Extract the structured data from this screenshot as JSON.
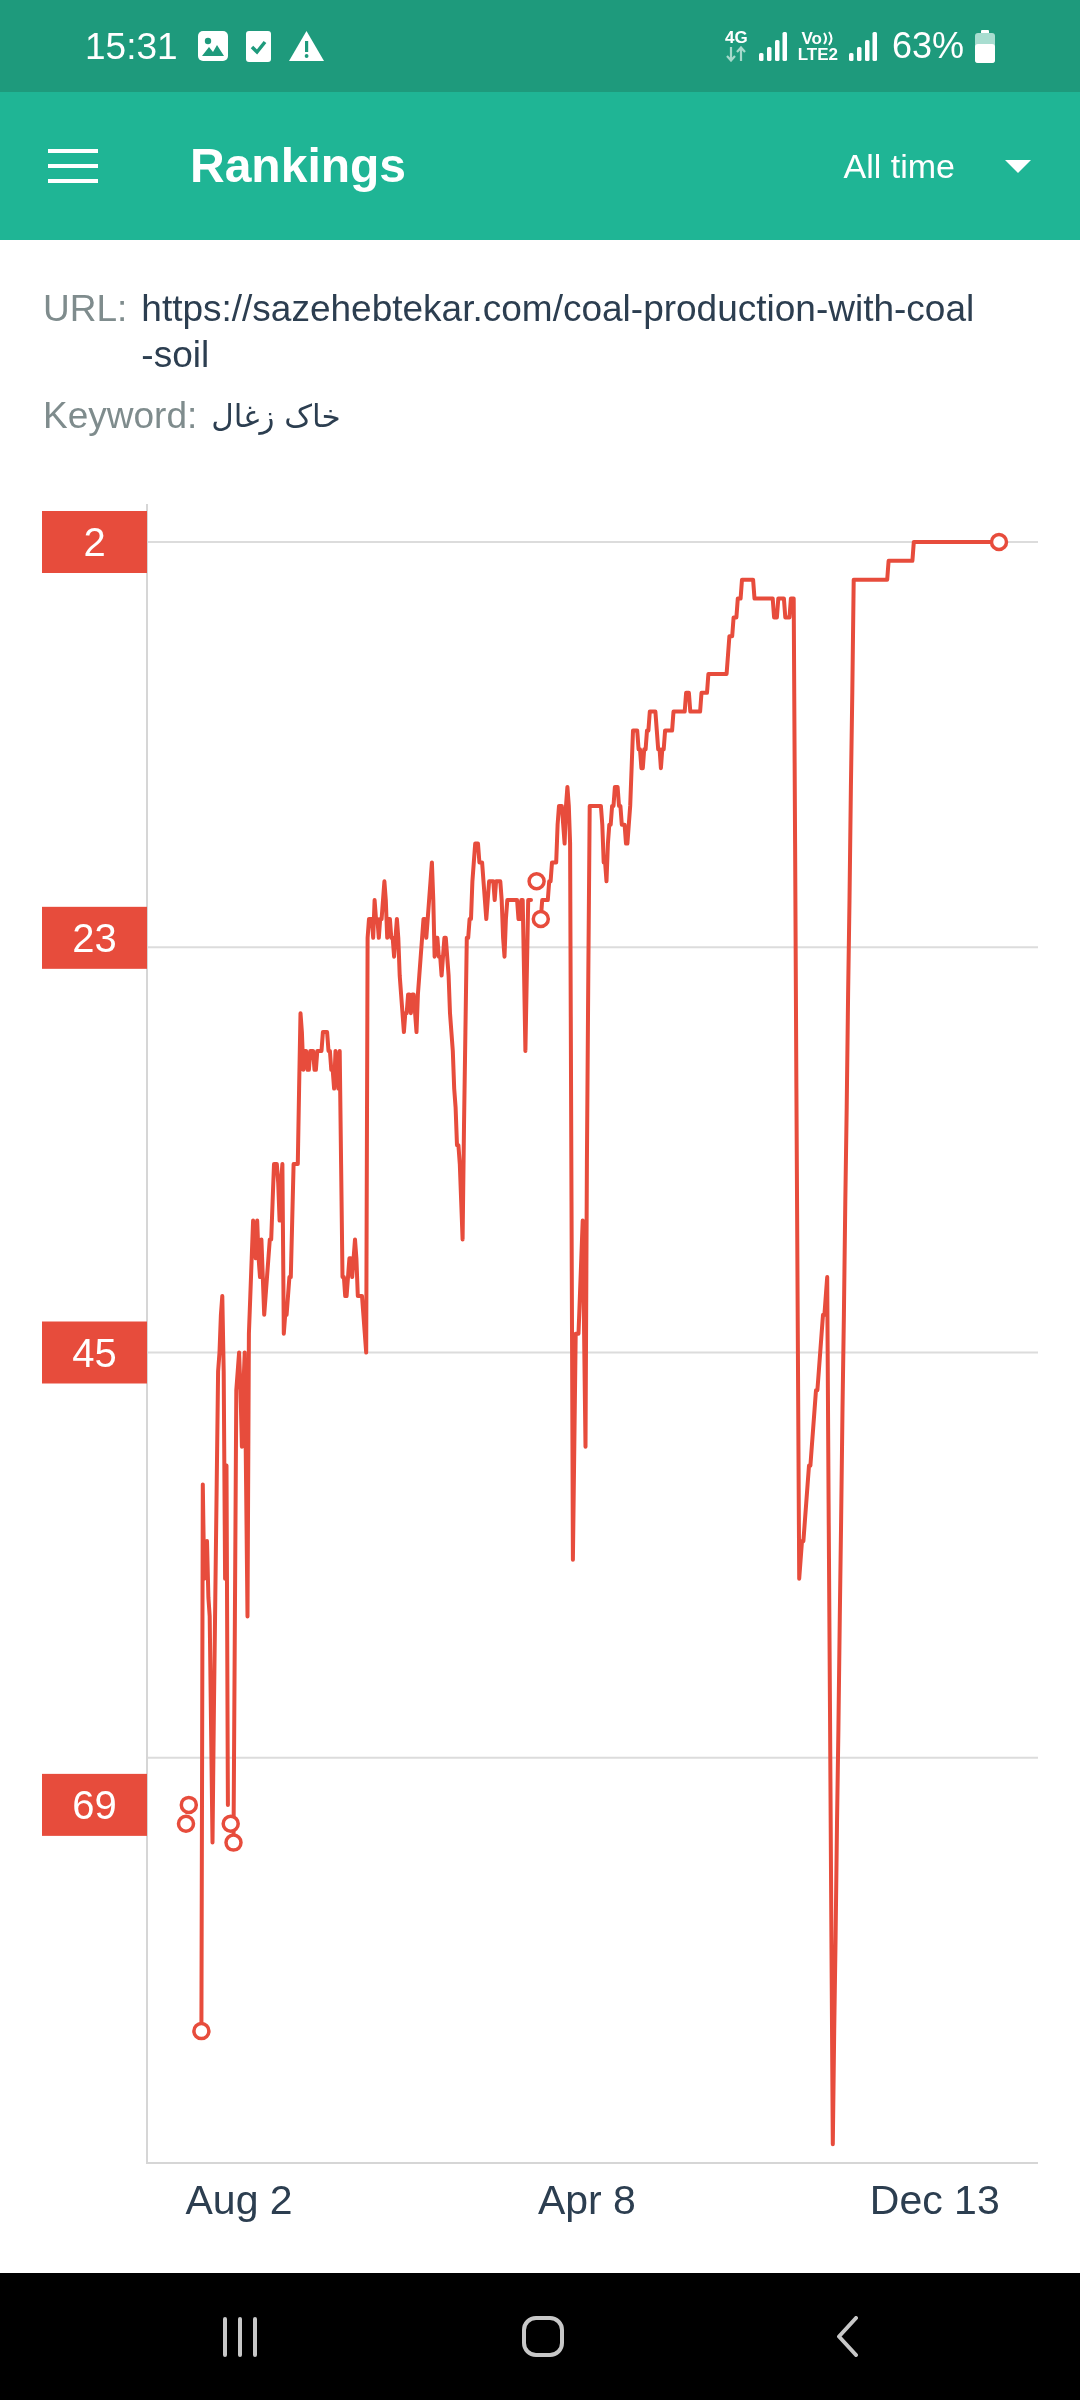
{
  "status_bar": {
    "time": "15:31",
    "network_type": "4G",
    "volte": "Vo",
    "volte_sub": "LTE2",
    "battery": "63%"
  },
  "app_bar": {
    "title": "Rankings",
    "period": "All time"
  },
  "details": {
    "url": {
      "label": "URL:",
      "lines": [
        "https://sazehebtekar.com/coal-production-with-coal",
        "-soil"
      ]
    },
    "keyword": {
      "label": "Keyword:",
      "value": "خاک زغال"
    }
  },
  "chart": {
    "chart_data": {
      "type": "line",
      "categories": [
        null,
        null,
        null,
        null,
        null,
        null,
        null,
        null,
        null,
        null,
        null,
        null,
        null,
        null,
        null,
        null,
        null,
        null,
        null,
        null,
        null,
        null,
        null,
        null,
        null,
        null,
        null,
        null,
        null,
        null,
        null,
        null,
        null,
        null,
        null,
        null,
        null,
        null,
        "Aug 2",
        null,
        null,
        null,
        null,
        null,
        null,
        null,
        null,
        null,
        null,
        null,
        null,
        null,
        null,
        null,
        null,
        null,
        null,
        null,
        null,
        null,
        null,
        null,
        null,
        null,
        null,
        null,
        null,
        null,
        null,
        null,
        null,
        null,
        null,
        null,
        null,
        null,
        null,
        null,
        null,
        null,
        null,
        null,
        null,
        null,
        null,
        null,
        null,
        null,
        null,
        null,
        null,
        null,
        null,
        null,
        null,
        null,
        null,
        null,
        null,
        null,
        null,
        null,
        null,
        null,
        null,
        null,
        null,
        null,
        null,
        null,
        null,
        null,
        null,
        null,
        null,
        null,
        null,
        null,
        null,
        null,
        null,
        null,
        null,
        null,
        null,
        null,
        null,
        null,
        null,
        null,
        null,
        null,
        null,
        null,
        null,
        null,
        null,
        null,
        null,
        null,
        null,
        null,
        null,
        null,
        null,
        null,
        null,
        null,
        null,
        null,
        null,
        null,
        null,
        null,
        null,
        null,
        null,
        null,
        null,
        null,
        null,
        null,
        null,
        null,
        null,
        null,
        null,
        null,
        null,
        null,
        null,
        null,
        null,
        null,
        null,
        null,
        null,
        null,
        null,
        null,
        null,
        null,
        null,
        null,
        null,
        null,
        null,
        null,
        null,
        null,
        null,
        null,
        null,
        null,
        null,
        null,
        null,
        null,
        null,
        null,
        null,
        null,
        null,
        null,
        null,
        null,
        null,
        null,
        null,
        null,
        null,
        null,
        null,
        null,
        null,
        null,
        null,
        null,
        null,
        null,
        null,
        null,
        null,
        null,
        null,
        null,
        null,
        null,
        null,
        null,
        null,
        null,
        null,
        null,
        null,
        null,
        null,
        null,
        null,
        null,
        null,
        null,
        null,
        null,
        null,
        null,
        null,
        null,
        null,
        null,
        null,
        null,
        null,
        null,
        null,
        null,
        null,
        null,
        null,
        null,
        null,
        null,
        null,
        null,
        null,
        null,
        null,
        null,
        null,
        null,
        null,
        null,
        null,
        null,
        null,
        null,
        null,
        null,
        null,
        null,
        null,
        null,
        null,
        null,
        null,
        null,
        null,
        "Apr 8",
        null,
        null,
        null,
        null,
        null,
        null,
        null,
        null,
        null,
        null,
        null,
        null,
        null,
        null,
        null,
        null,
        null,
        null,
        null,
        null,
        null,
        null,
        null,
        null,
        null,
        null,
        null,
        null,
        null,
        null,
        null,
        null,
        null,
        null,
        null,
        null,
        null,
        null,
        null,
        null,
        null,
        null,
        null,
        null,
        null,
        null,
        null,
        null,
        null,
        null,
        null,
        null,
        null,
        null,
        null,
        null,
        null,
        null,
        null,
        null,
        null,
        null,
        null,
        null,
        null,
        null,
        null,
        null,
        null,
        null,
        null,
        null,
        null,
        null,
        null,
        null,
        null,
        null,
        null,
        null,
        null,
        null,
        null,
        null,
        null,
        null,
        null,
        null,
        null,
        null,
        null,
        null,
        null,
        null,
        null,
        null,
        null,
        null,
        null,
        null,
        null,
        null,
        null,
        null,
        null,
        null,
        null,
        null,
        null,
        null,
        null,
        null,
        null,
        null,
        null,
        null,
        null,
        null,
        null,
        null,
        null,
        null,
        null,
        null,
        null,
        null,
        null,
        null,
        null,
        null,
        null,
        null,
        null,
        null,
        null,
        null,
        null,
        null,
        null,
        null,
        null,
        null,
        null,
        null,
        null,
        null,
        null,
        null,
        null,
        null,
        null,
        null,
        null,
        null,
        null,
        null,
        null,
        null,
        null,
        null,
        null,
        null,
        null,
        null,
        null,
        null,
        null,
        null,
        null,
        null,
        null,
        null,
        null,
        null,
        null,
        null,
        null,
        null,
        null,
        null,
        null,
        null,
        null,
        null,
        null,
        null,
        null,
        null,
        null,
        null,
        null,
        null,
        null,
        null,
        null,
        null,
        null,
        null,
        null,
        null,
        null,
        null,
        null,
        null,
        null,
        null,
        null,
        null,
        null,
        null,
        null,
        null,
        null,
        null,
        null,
        null,
        null,
        null,
        null,
        null,
        null,
        null,
        null,
        null,
        null,
        null,
        null,
        null,
        null,
        null,
        null,
        null,
        null,
        null,
        null,
        null,
        null,
        null,
        null,
        null,
        null,
        null,
        null,
        null,
        null,
        null,
        null,
        null,
        "Dec 13",
        null,
        null,
        null,
        null,
        null,
        null,
        null,
        null,
        null,
        null,
        null,
        null,
        null,
        null,
        null,
        null,
        null,
        null,
        null,
        null,
        null,
        null,
        null,
        null,
        null,
        null,
        null,
        null,
        null,
        null,
        null,
        null,
        null,
        null,
        null,
        null,
        null,
        null,
        null,
        null,
        null,
        null,
        null,
        null,
        null,
        null
      ],
      "series": [
        {
          "color": "#e74c3c",
          "values": [
            70,
            null,
            69,
            null,
            null,
            null,
            null,
            null,
            null,
            null,
            null,
            81,
            52,
            57,
            56,
            55,
            58,
            59,
            65,
            71,
            64,
            58,
            52,
            46,
            45,
            43,
            42,
            46,
            57,
            51,
            69,
            null,
            70,
            null,
            71,
            59,
            47,
            46,
            45,
            47,
            50,
            47,
            45,
            52,
            59,
            44,
            42,
            40,
            38,
            39,
            40,
            38,
            40,
            41,
            39,
            41,
            43,
            42,
            41,
            40,
            39,
            39,
            37,
            35,
            35,
            35,
            36,
            38,
            36,
            35,
            44,
            43,
            43,
            42,
            41,
            41,
            38,
            35,
            35,
            35,
            35,
            31,
            27,
            28,
            30,
            29,
            29,
            30,
            30,
            29,
            29,
            29,
            30,
            30,
            29,
            29,
            29,
            29,
            28,
            28,
            28,
            28,
            29,
            29,
            30,
            30,
            31,
            29,
            30,
            31,
            29,
            35,
            41,
            41,
            42,
            42,
            41,
            40,
            40,
            41,
            40,
            39,
            40,
            42,
            42,
            42,
            42,
            43,
            44,
            45,
            23,
            22,
            22,
            22,
            23,
            21,
            22,
            22,
            23,
            22,
            22,
            21,
            20,
            21,
            23,
            22,
            22,
            23,
            23,
            24,
            23,
            22,
            23,
            25,
            26,
            27,
            28,
            27,
            27,
            26,
            26,
            27,
            26,
            26,
            27,
            28,
            26,
            25,
            24,
            23,
            22,
            22,
            23,
            22,
            21,
            20,
            19,
            21,
            24,
            23,
            23,
            24,
            24,
            25,
            24,
            23,
            23,
            24,
            25,
            27,
            28,
            29,
            31,
            32,
            34,
            34,
            35,
            37,
            39,
            33,
            28,
            23,
            23,
            22,
            22,
            20,
            19,
            18,
            18,
            18,
            19,
            19,
            19,
            20,
            21,
            22,
            21,
            20,
            20,
            20,
            20,
            21,
            20,
            20,
            20,
            20,
            21,
            23,
            24,
            22,
            21,
            21,
            21,
            21,
            21,
            21,
            21,
            21,
            22,
            22,
            21,
            21,
            25,
            29,
            25,
            21,
            21,
            21,
            null,
            null,
            null,
            20,
            null,
            null,
            22,
            21,
            21,
            21,
            21,
            21,
            20,
            20,
            19,
            19,
            19,
            19,
            17,
            16,
            16,
            16,
            17,
            18,
            16,
            15,
            16,
            18,
            37,
            56,
            50,
            44,
            44,
            44,
            42,
            40,
            38,
            44,
            50,
            35,
            25,
            16,
            16,
            16,
            16,
            16,
            16,
            16,
            16,
            16,
            17,
            19,
            19,
            20,
            18,
            17,
            17,
            16,
            16,
            15,
            15,
            15,
            16,
            16,
            17,
            17,
            17,
            18,
            18,
            17,
            16,
            14,
            12,
            12,
            12,
            12,
            13,
            13,
            14,
            14,
            13,
            13,
            12,
            12,
            11,
            11,
            11,
            11,
            11,
            12,
            13,
            13,
            14,
            13,
            13,
            12,
            12,
            12,
            12,
            12,
            12,
            11,
            11,
            11,
            11,
            11,
            11,
            11,
            11,
            11,
            10,
            10,
            10,
            11,
            11,
            11,
            11,
            11,
            11,
            11,
            11,
            10,
            10,
            10,
            10,
            10,
            9,
            9,
            9,
            9,
            9,
            9,
            9,
            9,
            9,
            9,
            9,
            9,
            9,
            9,
            8,
            7,
            7,
            7,
            6,
            6,
            6,
            5,
            5,
            5,
            4,
            4,
            4,
            4,
            4,
            4,
            4,
            4,
            4,
            5,
            5,
            5,
            5,
            5,
            5,
            5,
            5,
            5,
            5,
            5,
            5,
            5,
            5,
            6,
            6,
            6,
            5,
            5,
            5,
            5,
            5,
            6,
            6,
            6,
            6,
            5,
            5,
            5,
            18,
            31,
            44,
            57,
            56,
            55,
            55,
            54,
            53,
            52,
            51,
            51,
            50,
            49,
            48,
            47,
            47,
            46,
            45,
            44,
            43,
            43,
            42,
            41,
            53,
            64,
            76,
            87,
            81,
            76,
            70,
            65,
            59,
            54,
            48,
            43,
            37,
            32,
            26,
            21,
            15,
            10,
            4,
            4,
            4,
            4,
            4,
            4,
            4,
            4,
            4,
            4,
            4,
            4,
            4,
            4,
            4,
            4,
            4,
            4,
            4,
            4,
            4,
            4,
            4,
            4,
            4,
            3,
            3,
            3,
            3,
            3,
            3,
            3,
            3,
            3,
            3,
            3,
            3,
            3,
            3,
            3,
            3,
            3,
            3,
            2,
            2,
            2,
            2,
            2,
            2,
            2,
            2,
            2,
            2,
            2,
            2,
            2,
            2,
            2,
            2,
            2,
            2,
            2,
            2,
            2,
            2,
            2,
            2,
            2,
            2,
            2,
            2,
            2,
            2,
            2,
            2,
            2,
            2,
            2,
            2,
            2,
            2,
            2,
            2,
            2,
            2,
            2,
            2,
            2,
            2,
            2,
            2,
            2,
            2,
            2,
            2,
            2,
            2,
            2,
            2,
            2,
            2,
            2,
            2,
            2,
            2
          ]
        }
      ],
      "ylim": [
        88,
        2
      ],
      "yticks": [
        2,
        23,
        45,
        69
      ]
    }
  }
}
